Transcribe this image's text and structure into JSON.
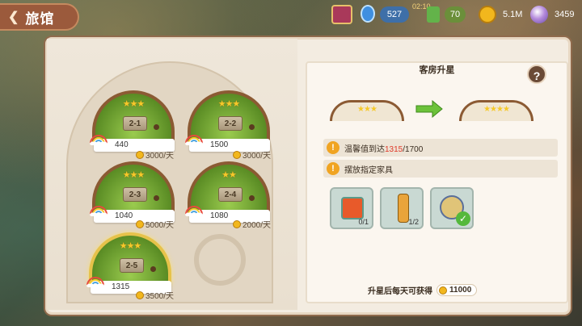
{
  "header": {
    "back_title": "旅馆"
  },
  "resources": {
    "energy": "527",
    "timer": "02:10",
    "tool": "70",
    "gold": "5.1M",
    "gems": "3459"
  },
  "rooms": [
    {
      "id": "2-1",
      "stars": "★★★",
      "value": "440",
      "price": "3000/天",
      "selected": false
    },
    {
      "id": "2-2",
      "stars": "★★★",
      "value": "1500",
      "price": "3000/天",
      "selected": false
    },
    {
      "id": "2-3",
      "stars": "★★★",
      "value": "1040",
      "price": "5000/天",
      "selected": false
    },
    {
      "id": "2-4",
      "stars": "★★",
      "value": "1080",
      "price": "2000/天",
      "selected": false
    },
    {
      "id": "2-5",
      "stars": "★★★",
      "value": "1315",
      "price": "3500/天",
      "selected": true
    }
  ],
  "upgrade": {
    "title": "客房升星",
    "help": "?",
    "current_stars": "★★★",
    "next_stars": "★★★★",
    "req1_prefix": "温馨值到达",
    "req1_current": "1315",
    "req1_total": "/1700",
    "req2": "摆放指定家具",
    "items": [
      {
        "icon": "fish-painting-icon",
        "count": "0/1"
      },
      {
        "icon": "bottle-icon",
        "count": "1/2"
      },
      {
        "icon": "shell-lamp-icon",
        "count": ""
      }
    ],
    "reward_label": "升星后每天可获得",
    "reward_value": "11000"
  }
}
